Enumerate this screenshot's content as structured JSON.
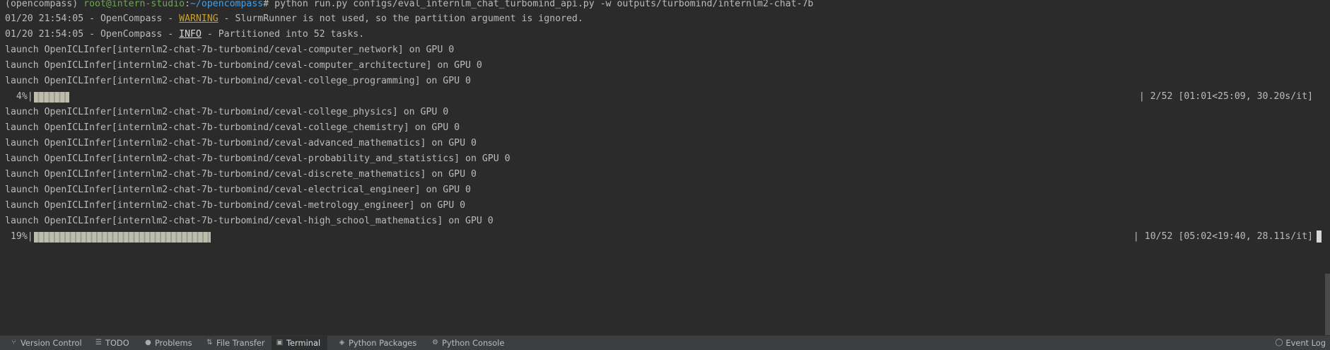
{
  "terminal": {
    "prompt": {
      "env": "(opencompass) ",
      "user_host": "root@intern-studio",
      "colon": ":",
      "path": "~/opencompass",
      "hash_cmd": "# python run.py configs/eval_internlm_chat_turbomind_api.py -w outputs/turbomind/internlm2-chat-7b"
    },
    "log1": {
      "prefix": "01/20 21:54:05 - OpenCompass - ",
      "level": "WARNING",
      "message": " - SlurmRunner is not used, so the partition argument is ignored."
    },
    "log2": {
      "prefix": "01/20 21:54:05 - OpenCompass - ",
      "level": "INFO",
      "message": " - Partitioned into 52 tasks."
    },
    "launch_group1": [
      "launch OpenICLInfer[internlm2-chat-7b-turbomind/ceval-computer_network] on GPU 0",
      "launch OpenICLInfer[internlm2-chat-7b-turbomind/ceval-computer_architecture] on GPU 0",
      "launch OpenICLInfer[internlm2-chat-7b-turbomind/ceval-college_programming] on GPU 0"
    ],
    "progress1": {
      "percent_text": "  4%|",
      "fraction": 0.0385,
      "stats": "| 2/52 [01:01<25:09, 30.20s/it]"
    },
    "launch_group2": [
      "launch OpenICLInfer[internlm2-chat-7b-turbomind/ceval-college_physics] on GPU 0",
      "launch OpenICLInfer[internlm2-chat-7b-turbomind/ceval-college_chemistry] on GPU 0",
      "launch OpenICLInfer[internlm2-chat-7b-turbomind/ceval-advanced_mathematics] on GPU 0",
      "launch OpenICLInfer[internlm2-chat-7b-turbomind/ceval-probability_and_statistics] on GPU 0",
      "launch OpenICLInfer[internlm2-chat-7b-turbomind/ceval-discrete_mathematics] on GPU 0",
      "launch OpenICLInfer[internlm2-chat-7b-turbomind/ceval-electrical_engineer] on GPU 0",
      "launch OpenICLInfer[internlm2-chat-7b-turbomind/ceval-metrology_engineer] on GPU 0",
      "launch OpenICLInfer[internlm2-chat-7b-turbomind/ceval-high_school_mathematics] on GPU 0"
    ],
    "progress2": {
      "percent_text": " 19%|",
      "fraction": 0.1923,
      "stats": "| 10/52 [05:02<19:40, 28.11s/it]"
    }
  },
  "toolbar": {
    "items": [
      {
        "label": "Version Control",
        "icon": "branch-icon"
      },
      {
        "label": "TODO",
        "icon": "list-icon"
      },
      {
        "label": "Problems",
        "icon": "info-icon"
      },
      {
        "label": "File Transfer",
        "icon": "transfer-icon"
      },
      {
        "label": "Terminal",
        "icon": "terminal-icon",
        "active": true
      },
      {
        "label": "Python Packages",
        "icon": "layers-icon"
      },
      {
        "label": "Python Console",
        "icon": "python-icon"
      }
    ],
    "right": {
      "label": "Event Log",
      "icon": "search-bubble-icon"
    }
  },
  "colors": {
    "background": "#2b2b2b",
    "text": "#bbbbbb",
    "prompt_user": "#6aa84f",
    "prompt_path": "#4a9fe0",
    "warning": "#c7a032"
  }
}
